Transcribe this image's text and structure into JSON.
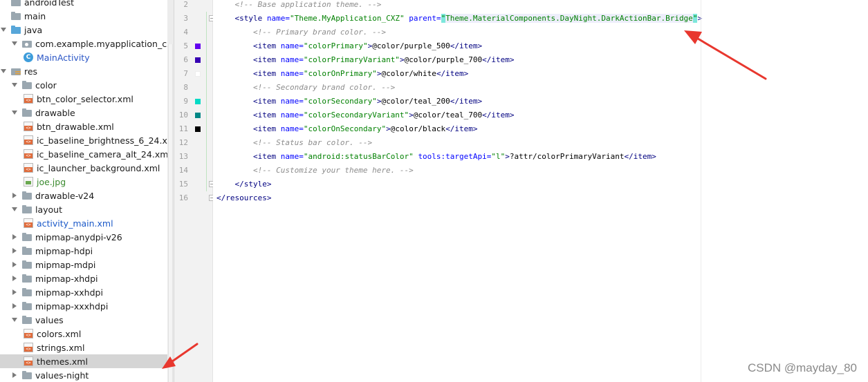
{
  "project_tree": {
    "items": [
      {
        "label": "androidTest",
        "icon": "folder-icon",
        "expanded": null
      },
      {
        "label": "main",
        "icon": "folder-icon",
        "expanded": null
      },
      {
        "label": "java",
        "icon": "folder-blue-icon",
        "expanded": true
      },
      {
        "label": "com.example.myapplication_cxz",
        "icon": "package-icon",
        "expanded": true
      },
      {
        "label": "MainActivity",
        "icon": "class-icon",
        "expanded": null
      },
      {
        "label": "res",
        "icon": "res-folder-icon",
        "expanded": true
      },
      {
        "label": "color",
        "icon": "folder-icon",
        "expanded": true
      },
      {
        "label": "btn_color_selector.xml",
        "icon": "xml-file-icon",
        "expanded": null
      },
      {
        "label": "drawable",
        "icon": "folder-icon",
        "expanded": true
      },
      {
        "label": "btn_drawable.xml",
        "icon": "xml-file-icon",
        "expanded": null
      },
      {
        "label": "ic_baseline_brightness_6_24.xml",
        "icon": "xml-file-icon",
        "expanded": null
      },
      {
        "label": "ic_baseline_camera_alt_24.xml",
        "icon": "xml-file-icon",
        "expanded": null
      },
      {
        "label": "ic_launcher_background.xml",
        "icon": "xml-file-icon",
        "expanded": null
      },
      {
        "label": "joe.jpg",
        "icon": "image-file-icon",
        "expanded": null
      },
      {
        "label": "drawable-v24",
        "icon": "folder-icon",
        "expanded": false
      },
      {
        "label": "layout",
        "icon": "folder-icon",
        "expanded": true
      },
      {
        "label": "activity_main.xml",
        "icon": "xml-file-icon",
        "expanded": null
      },
      {
        "label": "mipmap-anydpi-v26",
        "icon": "folder-icon",
        "expanded": false
      },
      {
        "label": "mipmap-hdpi",
        "icon": "folder-icon",
        "expanded": false
      },
      {
        "label": "mipmap-mdpi",
        "icon": "folder-icon",
        "expanded": false
      },
      {
        "label": "mipmap-xhdpi",
        "icon": "folder-icon",
        "expanded": false
      },
      {
        "label": "mipmap-xxhdpi",
        "icon": "folder-icon",
        "expanded": false
      },
      {
        "label": "mipmap-xxxhdpi",
        "icon": "folder-icon",
        "expanded": false
      },
      {
        "label": "values",
        "icon": "folder-icon",
        "expanded": true
      },
      {
        "label": "colors.xml",
        "icon": "xml-file-icon",
        "expanded": null
      },
      {
        "label": "strings.xml",
        "icon": "xml-file-icon",
        "expanded": null
      },
      {
        "label": "themes.xml",
        "icon": "xml-file-icon",
        "expanded": null,
        "selected": true
      },
      {
        "label": "values-night",
        "icon": "folder-icon",
        "expanded": false
      }
    ]
  },
  "editor": {
    "lines": [
      {
        "number": "2",
        "segments": [
          {
            "t": "    "
          },
          {
            "t": "<!-- Base application theme. -->",
            "c": "comment"
          }
        ]
      },
      {
        "number": "3",
        "segments": [
          {
            "t": "    "
          },
          {
            "t": "<style",
            "c": "tag"
          },
          {
            "t": " "
          },
          {
            "t": "name=",
            "c": "attr"
          },
          {
            "t": "\"Theme.MyApplication_CXZ\"",
            "c": "val"
          },
          {
            "t": " "
          },
          {
            "t": "parent=",
            "c": "attr"
          },
          {
            "t": "\"",
            "c": "val hl"
          },
          {
            "t": "Theme.MaterialComponents.DayNight.DarkActionBar.Bridge",
            "c": "val sel"
          },
          {
            "t": "\"",
            "c": "val hl"
          },
          {
            "t": ">",
            "c": "tag"
          }
        ]
      },
      {
        "number": "4",
        "segments": [
          {
            "t": "        "
          },
          {
            "t": "<!-- Primary brand color. -->",
            "c": "comment"
          }
        ]
      },
      {
        "number": "5",
        "swatch": "#6200ee",
        "segments": [
          {
            "t": "        "
          },
          {
            "t": "<item",
            "c": "tag"
          },
          {
            "t": " "
          },
          {
            "t": "name=",
            "c": "attr"
          },
          {
            "t": "\"colorPrimary\"",
            "c": "val"
          },
          {
            "t": ">",
            "c": "tag"
          },
          {
            "t": "@color/purple_500",
            "c": "text"
          },
          {
            "t": "</item>",
            "c": "tag"
          }
        ]
      },
      {
        "number": "6",
        "swatch": "#3700b3",
        "segments": [
          {
            "t": "        "
          },
          {
            "t": "<item",
            "c": "tag"
          },
          {
            "t": " "
          },
          {
            "t": "name=",
            "c": "attr"
          },
          {
            "t": "\"colorPrimaryVariant\"",
            "c": "val"
          },
          {
            "t": ">",
            "c": "tag"
          },
          {
            "t": "@color/purple_700",
            "c": "text"
          },
          {
            "t": "</item>",
            "c": "tag"
          }
        ]
      },
      {
        "number": "7",
        "swatch": "#ffffff",
        "segments": [
          {
            "t": "        "
          },
          {
            "t": "<item",
            "c": "tag"
          },
          {
            "t": " "
          },
          {
            "t": "name=",
            "c": "attr"
          },
          {
            "t": "\"colorOnPrimary\"",
            "c": "val"
          },
          {
            "t": ">",
            "c": "tag"
          },
          {
            "t": "@color/white",
            "c": "text"
          },
          {
            "t": "</item>",
            "c": "tag"
          }
        ]
      },
      {
        "number": "8",
        "segments": [
          {
            "t": "        "
          },
          {
            "t": "<!-- Secondary brand color. -->",
            "c": "comment"
          }
        ]
      },
      {
        "number": "9",
        "swatch": "#03dac5",
        "segments": [
          {
            "t": "        "
          },
          {
            "t": "<item",
            "c": "tag"
          },
          {
            "t": " "
          },
          {
            "t": "name=",
            "c": "attr"
          },
          {
            "t": "\"colorSecondary\"",
            "c": "val"
          },
          {
            "t": ">",
            "c": "tag"
          },
          {
            "t": "@color/teal_200",
            "c": "text"
          },
          {
            "t": "</item>",
            "c": "tag"
          }
        ]
      },
      {
        "number": "10",
        "swatch": "#018786",
        "segments": [
          {
            "t": "        "
          },
          {
            "t": "<item",
            "c": "tag"
          },
          {
            "t": " "
          },
          {
            "t": "name=",
            "c": "attr"
          },
          {
            "t": "\"colorSecondaryVariant\"",
            "c": "val"
          },
          {
            "t": ">",
            "c": "tag"
          },
          {
            "t": "@color/teal_700",
            "c": "text"
          },
          {
            "t": "</item>",
            "c": "tag"
          }
        ]
      },
      {
        "number": "11",
        "swatch": "#000000",
        "segments": [
          {
            "t": "        "
          },
          {
            "t": "<item",
            "c": "tag"
          },
          {
            "t": " "
          },
          {
            "t": "name=",
            "c": "attr"
          },
          {
            "t": "\"colorOnSecondary\"",
            "c": "val"
          },
          {
            "t": ">",
            "c": "tag"
          },
          {
            "t": "@color/black",
            "c": "text"
          },
          {
            "t": "</item>",
            "c": "tag"
          }
        ]
      },
      {
        "number": "12",
        "segments": [
          {
            "t": "        "
          },
          {
            "t": "<!-- Status bar color. -->",
            "c": "comment"
          }
        ]
      },
      {
        "number": "13",
        "segments": [
          {
            "t": "        "
          },
          {
            "t": "<item",
            "c": "tag"
          },
          {
            "t": " "
          },
          {
            "t": "name=",
            "c": "attr"
          },
          {
            "t": "\"android:statusBarColor\"",
            "c": "val"
          },
          {
            "t": " "
          },
          {
            "t": "tools:targetApi=",
            "c": "attr"
          },
          {
            "t": "\"l\"",
            "c": "val"
          },
          {
            "t": ">",
            "c": "tag"
          },
          {
            "t": "?attr/colorPrimaryVariant",
            "c": "text"
          },
          {
            "t": "</item>",
            "c": "tag"
          }
        ]
      },
      {
        "number": "14",
        "segments": [
          {
            "t": "        "
          },
          {
            "t": "<!-- Customize your theme here. -->",
            "c": "comment"
          }
        ]
      },
      {
        "number": "15",
        "segments": [
          {
            "t": "    "
          },
          {
            "t": "</style>",
            "c": "tag"
          }
        ]
      },
      {
        "number": "16",
        "segments": [
          {
            "t": "</resources>",
            "c": "tag"
          }
        ]
      }
    ]
  },
  "watermark": "CSDN @mayday_80",
  "colors": {
    "arrow": "#e8372e",
    "selection": "#d5d5d5",
    "caret_row": "#fcfaed"
  }
}
